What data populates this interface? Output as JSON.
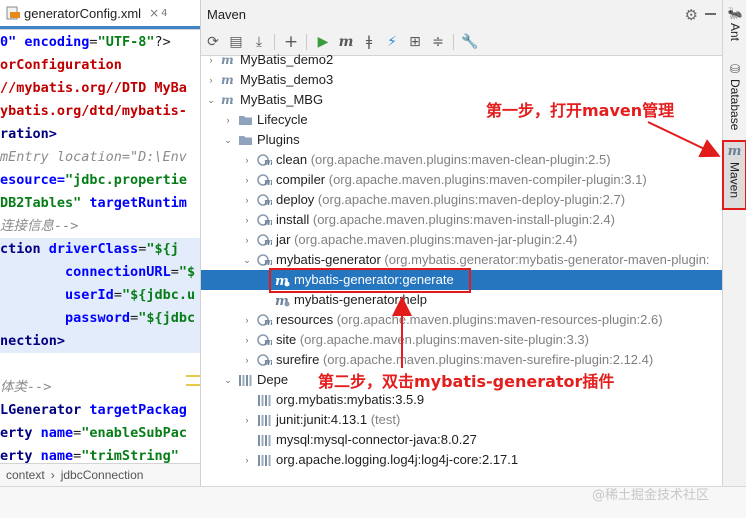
{
  "editor": {
    "tab_title": "generatorConfig.xml",
    "tab_close": "×",
    "tab_count": "4",
    "lines": [
      {
        "parts": [
          {
            "t": "0\" ",
            "c": "attr"
          },
          {
            "t": "encoding",
            "c": "attr"
          },
          {
            "t": "=",
            "c": ""
          },
          {
            "t": "\"UTF-8\"",
            "c": "str"
          },
          {
            "t": "?>",
            "c": ""
          }
        ]
      },
      {
        "parts": [
          {
            "t": "orConfiguration",
            "c": "red"
          }
        ]
      },
      {
        "parts": [
          {
            "t": "//mybatis.org//DTD MyBa",
            "c": "red"
          }
        ]
      },
      {
        "parts": [
          {
            "t": "ybatis.org/dtd/mybatis-",
            "c": "red"
          }
        ]
      },
      {
        "parts": [
          {
            "t": "ration>",
            "c": "tagref"
          }
        ]
      },
      {
        "parts": [
          {
            "t": "mEntry location=\"D:\\Env",
            "c": "cm"
          }
        ]
      },
      {
        "parts": [
          {
            "t": "esource=",
            "c": "attr"
          },
          {
            "t": "\"jdbc.propertie",
            "c": "str"
          }
        ]
      },
      {
        "parts": [
          {
            "t": "DB2Tables\" ",
            "c": "str"
          },
          {
            "t": "targetRuntim",
            "c": "attr"
          }
        ]
      },
      {
        "parts": [
          {
            "t": "连接信息-->",
            "c": "cm"
          }
        ]
      },
      {
        "parts": [
          {
            "t": "ction ",
            "c": "tagref"
          },
          {
            "t": "driverClass",
            "c": "attr"
          },
          {
            "t": "=",
            "c": ""
          },
          {
            "t": "\"${j",
            "c": "str"
          }
        ]
      },
      {
        "parts": [
          {
            "t": "        ",
            "c": ""
          },
          {
            "t": "connectionURL",
            "c": "attr"
          },
          {
            "t": "=",
            "c": ""
          },
          {
            "t": "\"$",
            "c": "str"
          }
        ]
      },
      {
        "parts": [
          {
            "t": "        ",
            "c": ""
          },
          {
            "t": "userId",
            "c": "attr"
          },
          {
            "t": "=",
            "c": ""
          },
          {
            "t": "\"${jdbc.u",
            "c": "str"
          }
        ]
      },
      {
        "parts": [
          {
            "t": "        ",
            "c": ""
          },
          {
            "t": "password",
            "c": "attr"
          },
          {
            "t": "=",
            "c": ""
          },
          {
            "t": "\"${jdbc",
            "c": "str"
          }
        ]
      },
      {
        "parts": [
          {
            "t": "nection>",
            "c": "tagref"
          }
        ]
      },
      {
        "parts": []
      },
      {
        "parts": [
          {
            "t": "体类-->",
            "c": "cm"
          }
        ]
      },
      {
        "parts": [
          {
            "t": "LGenerator ",
            "c": "tagref"
          },
          {
            "t": "targetPackag",
            "c": "attr"
          }
        ]
      },
      {
        "parts": [
          {
            "t": "erty ",
            "c": "tagref"
          },
          {
            "t": "name",
            "c": "attr"
          },
          {
            "t": "=",
            "c": ""
          },
          {
            "t": "\"enableSubPac",
            "c": "str"
          }
        ]
      },
      {
        "parts": [
          {
            "t": "erty ",
            "c": "tagref"
          },
          {
            "t": "name",
            "c": "attr"
          },
          {
            "t": "=",
            "c": ""
          },
          {
            "t": "\"trimString\"",
            "c": "str"
          }
        ]
      }
    ],
    "breadcrumb": [
      "context",
      "›",
      "jdbcConnection"
    ]
  },
  "maven": {
    "title": "Maven",
    "toolbar_icons": [
      "reload-icon",
      "reimport-folder-icon",
      "download-icon",
      "add-icon",
      "run-icon",
      "maven-goal-icon",
      "toggle-offline-icon",
      "skip-tests-icon",
      "show-dependencies-icon",
      "collapse-all-icon",
      "settings-wrench-icon"
    ],
    "tree": [
      {
        "label": "MyBatis_demo2",
        "depth": 0,
        "arrow": "›",
        "icon": "mv",
        "detail": ""
      },
      {
        "label": "MyBatis_demo3",
        "depth": 0,
        "arrow": "›",
        "icon": "mv",
        "detail": ""
      },
      {
        "label": "MyBatis_MBG",
        "depth": 0,
        "arrow": "⌄",
        "icon": "mv",
        "detail": ""
      },
      {
        "label": "Lifecycle",
        "depth": 1,
        "arrow": "›",
        "icon": "folder",
        "detail": ""
      },
      {
        "label": "Plugins",
        "depth": 1,
        "arrow": "⌄",
        "icon": "folder",
        "detail": ""
      },
      {
        "label": "clean",
        "depth": 2,
        "arrow": "›",
        "icon": "plugin",
        "detail": " (org.apache.maven.plugins:maven-clean-plugin:2.5)"
      },
      {
        "label": "compiler",
        "depth": 2,
        "arrow": "›",
        "icon": "plugin",
        "detail": " (org.apache.maven.plugins:maven-compiler-plugin:3.1)"
      },
      {
        "label": "deploy",
        "depth": 2,
        "arrow": "›",
        "icon": "plugin",
        "detail": " (org.apache.maven.plugins:maven-deploy-plugin:2.7)"
      },
      {
        "label": "install",
        "depth": 2,
        "arrow": "›",
        "icon": "plugin",
        "detail": " (org.apache.maven.plugins:maven-install-plugin:2.4)"
      },
      {
        "label": "jar",
        "depth": 2,
        "arrow": "›",
        "icon": "plugin",
        "detail": " (org.apache.maven.plugins:maven-jar-plugin:2.4)"
      },
      {
        "label": "mybatis-generator",
        "depth": 2,
        "arrow": "⌄",
        "icon": "plugin",
        "detail": " (org.mybatis.generator:mybatis-generator-maven-plugin:"
      },
      {
        "label": "mybatis-generator:generate",
        "depth": 3,
        "arrow": "",
        "icon": "goal",
        "detail": "",
        "selected": true
      },
      {
        "label": "mybatis-generator:help",
        "depth": 3,
        "arrow": "",
        "icon": "goal",
        "detail": ""
      },
      {
        "label": "resources",
        "depth": 2,
        "arrow": "›",
        "icon": "plugin",
        "detail": " (org.apache.maven.plugins:maven-resources-plugin:2.6)"
      },
      {
        "label": "site",
        "depth": 2,
        "arrow": "›",
        "icon": "plugin",
        "detail": " (org.apache.maven.plugins:maven-site-plugin:3.3)"
      },
      {
        "label": "surefire",
        "depth": 2,
        "arrow": "›",
        "icon": "plugin",
        "detail": " (org.apache.maven.plugins:maven-surefire-plugin:2.12.4)"
      },
      {
        "label": "Depe",
        "depth": 1,
        "arrow": "⌄",
        "icon": "lib",
        "detail": ""
      },
      {
        "label": "org.mybatis:mybatis:3.5.9",
        "depth": 2,
        "arrow": "",
        "icon": "lib",
        "detail": ""
      },
      {
        "label": "junit:junit:4.13.1",
        "depth": 2,
        "arrow": "›",
        "icon": "lib",
        "detail": " (test)"
      },
      {
        "label": "mysql:mysql-connector-java:8.0.27",
        "depth": 2,
        "arrow": "",
        "icon": "lib",
        "detail": ""
      },
      {
        "label": "org.apache.logging.log4j:log4j-core:2.17.1",
        "depth": 2,
        "arrow": "›",
        "icon": "lib",
        "detail": ""
      }
    ]
  },
  "rightbar": {
    "ant_label": "Ant",
    "database_label": "Database",
    "maven_label": "Maven"
  },
  "annotations": {
    "step1": "第一步，打开maven管理",
    "step2": "第二步，双击mybatis-generator插件",
    "accent": "#e21b1b"
  },
  "watermark": "@稀土掘金技术社区"
}
